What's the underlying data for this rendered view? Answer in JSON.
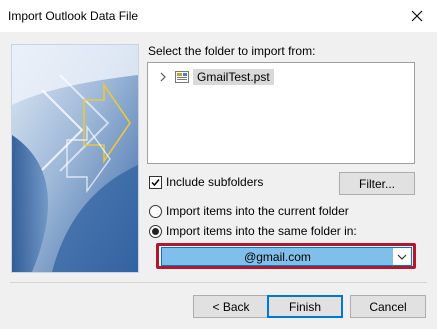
{
  "window": {
    "title": "Import Outlook Data File",
    "close_icon": "close-icon"
  },
  "folder_section": {
    "label": "Select the folder to import from:",
    "tree": [
      {
        "label": "GmailTest.pst",
        "icon": "pst-file-icon",
        "expander": "chevron-right-icon"
      }
    ]
  },
  "options": {
    "include_subfolders_label": "Include subfolders",
    "include_subfolders_checked": true,
    "filter_button": "Filter...",
    "radio_current_label": "Import items into the current folder",
    "radio_same_label": "Import items into the same folder in:",
    "selected_radio": "same",
    "target_account": "@gmail.com"
  },
  "buttons": {
    "back": "< Back",
    "finish": "Finish",
    "cancel": "Cancel"
  },
  "colors": {
    "highlight_frame": "#b0192c",
    "selection": "#7fbfea",
    "accent": "#0078d7"
  }
}
